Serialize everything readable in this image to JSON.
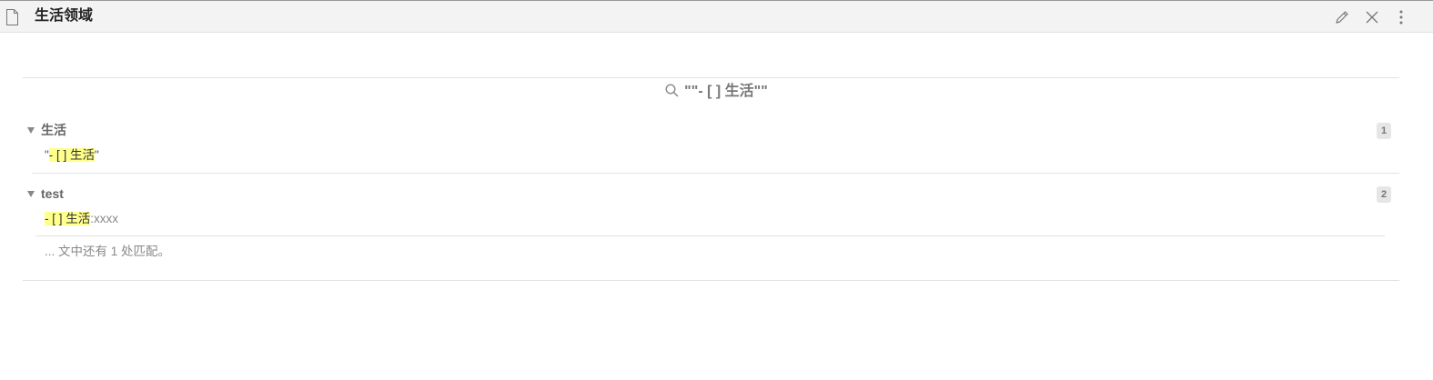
{
  "header": {
    "title": "生活领域"
  },
  "search": {
    "query": "\"\"- [ ] 生活\"\""
  },
  "results": [
    {
      "file": "生活",
      "count": "1",
      "match": {
        "before": "\"",
        "highlight": "- [ ] 生活",
        "after": "\""
      }
    },
    {
      "file": "test",
      "count": "2",
      "match": {
        "before": "",
        "highlight": "- [ ] 生活",
        "after": ":xxxx"
      },
      "more": "... 文中还有 1 处匹配。"
    }
  ],
  "icons": {
    "file": "file-icon",
    "edit": "pencil-icon",
    "close": "close-icon",
    "more": "more-vertical-icon",
    "search": "search-icon",
    "collapse": "caret-down-icon"
  },
  "colors": {
    "highlight": "#ffff8c",
    "header_bg": "#f3f3f4"
  }
}
